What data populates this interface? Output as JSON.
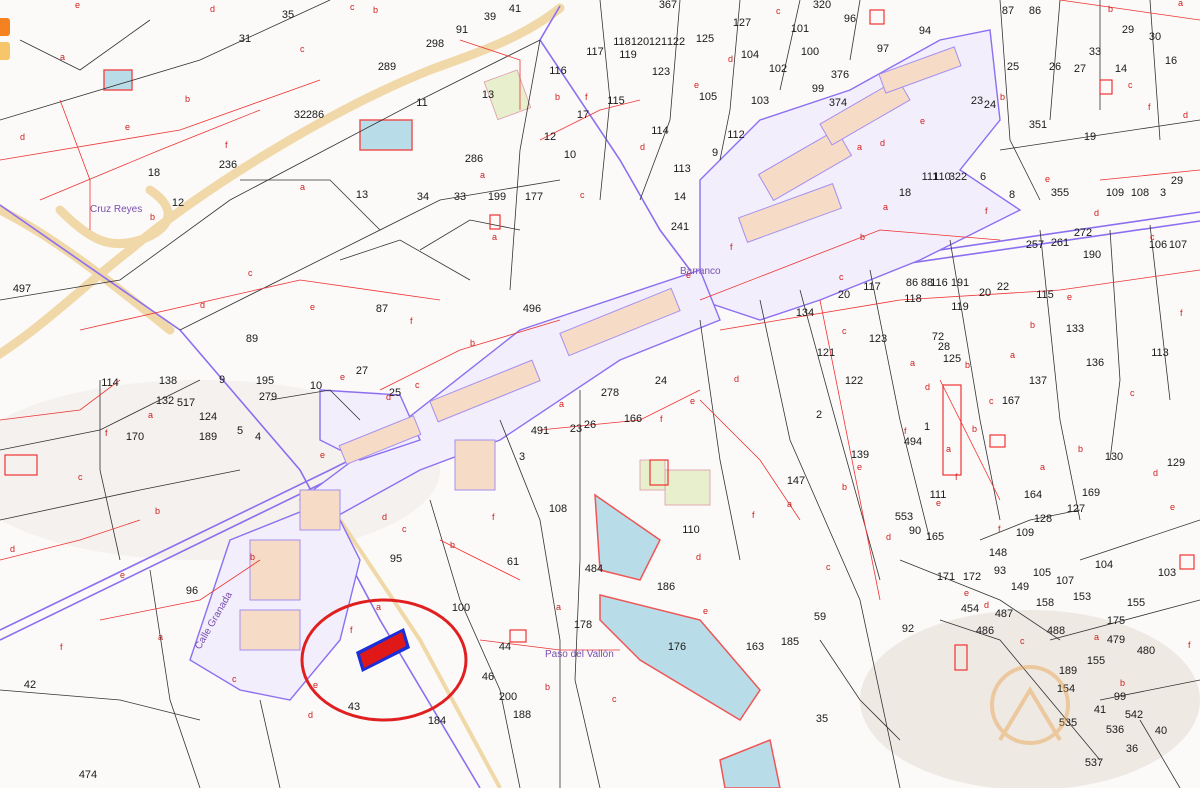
{
  "colors": {
    "parcel_line": "#333333",
    "subdivision_line": "#e33333",
    "urban_outline": "#8c6ff0",
    "building_fill": "#f6dcc6",
    "highway": "#f1d8a8",
    "water": "#b9dde8",
    "highlight_circle": "#e02020",
    "highlight_plot": "#e01818",
    "highlight_plot_border": "#1a2fd8",
    "tool_orange": "#f58220",
    "tool_yellow": "#f7c56a"
  },
  "tools": [
    {
      "name": "tool-button-orange",
      "icon": "orange-square-icon"
    },
    {
      "name": "tool-button-yellow",
      "icon": "yellow-square-icon"
    }
  ],
  "place_names": {
    "north_reyes": "Cruz Reyes",
    "village": "Barranco",
    "west_street": "Calle Granada",
    "south_road": "Paso del Vallón"
  },
  "parcels": [
    "35",
    "31",
    "39",
    "41",
    "367",
    "127",
    "320",
    "96",
    "87",
    "86",
    "298",
    "91",
    "117",
    "118",
    "120",
    "121",
    "122",
    "125",
    "101",
    "100",
    "97",
    "94",
    "30",
    "289",
    "116",
    "119",
    "123",
    "104",
    "102",
    "376",
    "25",
    "26",
    "27",
    "29",
    "33",
    "14",
    "16",
    "13",
    "115",
    "105",
    "103",
    "99",
    "374",
    "23",
    "24",
    "32",
    "286",
    "11",
    "17",
    "114",
    "112",
    "351",
    "19",
    "18",
    "236",
    "286",
    "12",
    "10",
    "113",
    "9",
    "111",
    "110",
    "322",
    "6",
    "8",
    "355",
    "12",
    "13",
    "14",
    "241",
    "18",
    "109",
    "108",
    "3",
    "29",
    "257",
    "261",
    "272",
    "106",
    "107",
    "190",
    "497",
    "496",
    "87",
    "86",
    "88",
    "191",
    "20",
    "22",
    "118",
    "119",
    "116",
    "115",
    "20",
    "117",
    "134",
    "133",
    "136",
    "113",
    "89",
    "72",
    "28",
    "125",
    "121",
    "122",
    "123",
    "137",
    "138",
    "132",
    "114",
    "9",
    "195",
    "10",
    "27",
    "279",
    "25",
    "24",
    "278",
    "26",
    "23",
    "491",
    "166",
    "167",
    "170",
    "517",
    "124",
    "189",
    "5",
    "4",
    "3",
    "2",
    "1",
    "494",
    "139",
    "130",
    "129",
    "147",
    "111",
    "90",
    "164",
    "128",
    "127",
    "108",
    "110",
    "553",
    "169",
    "165",
    "148",
    "109",
    "93",
    "149",
    "105",
    "107",
    "104",
    "103",
    "96",
    "95",
    "61",
    "484",
    "186",
    "171",
    "172",
    "454",
    "158",
    "153",
    "155",
    "100",
    "92",
    "59",
    "185",
    "163",
    "178",
    "176",
    "175",
    "479",
    "480",
    "42",
    "43",
    "44",
    "46",
    "200",
    "188",
    "184",
    "486",
    "487",
    "488",
    "189",
    "155",
    "154",
    "99",
    "542",
    "41",
    "40",
    "535",
    "536",
    "36",
    "537",
    "474",
    "35",
    "34",
    "33",
    "199",
    "177"
  ]
}
